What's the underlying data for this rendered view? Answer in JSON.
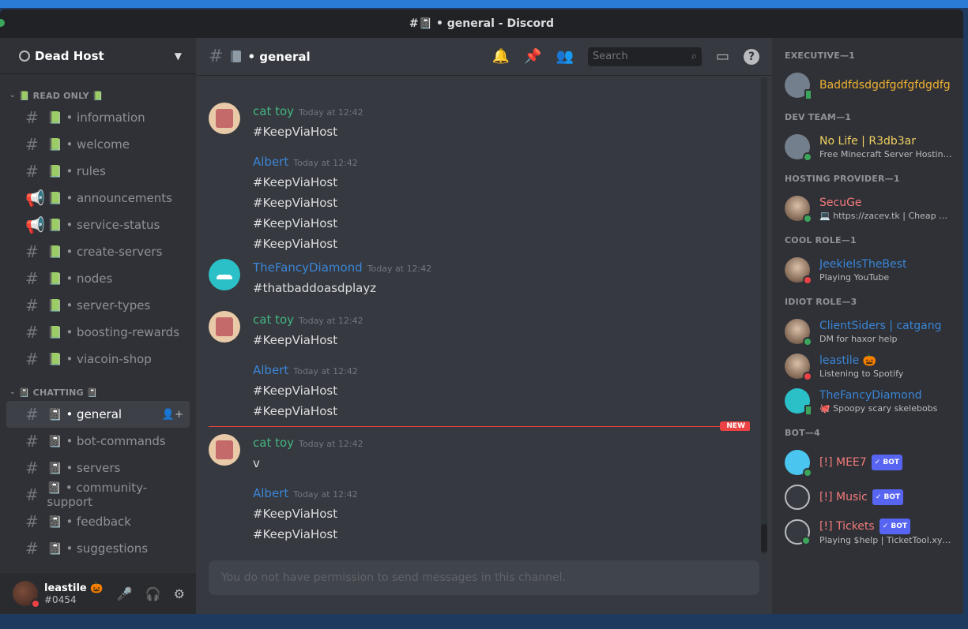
{
  "window": {
    "title": "#📓 • general - Discord"
  },
  "server": {
    "name": "Dead Host"
  },
  "categories": [
    {
      "label": "📗 READ ONLY 📗",
      "channels": [
        {
          "name": "📗 • information",
          "type": "text"
        },
        {
          "name": "📗 • welcome",
          "type": "text"
        },
        {
          "name": "📗 • rules",
          "type": "text"
        },
        {
          "name": "📗 • announcements",
          "type": "announcement"
        },
        {
          "name": "📗 • service-status",
          "type": "announcement"
        },
        {
          "name": "📗 • create-servers",
          "type": "text"
        },
        {
          "name": "📗 • nodes",
          "type": "text"
        },
        {
          "name": "📗 • server-types",
          "type": "text"
        },
        {
          "name": "📗 • boosting-rewards",
          "type": "text"
        },
        {
          "name": "📗 • viacoin-shop",
          "type": "text"
        }
      ]
    },
    {
      "label": "📓 CHATTING 📓",
      "channels": [
        {
          "name": "📓 • general",
          "type": "text",
          "active": true
        },
        {
          "name": "📓 • bot-commands",
          "type": "text"
        },
        {
          "name": "📓 • servers",
          "type": "text"
        },
        {
          "name": "📓 • community-support",
          "type": "text"
        },
        {
          "name": "📓 • feedback",
          "type": "text"
        },
        {
          "name": "📓 • suggestions",
          "type": "text"
        }
      ]
    }
  ],
  "user_panel": {
    "username": "leastile 🎃",
    "tag": "#0454"
  },
  "channel_header": {
    "name": "• general",
    "search_placeholder": "Search"
  },
  "messages": [
    {
      "author": "cat toy",
      "author_color": "#43b581",
      "avatar": "cat",
      "time": "Today at 12:42",
      "lines": [
        "#KeepViaHost"
      ]
    },
    {
      "author": "Albert",
      "author_color": "#3a86d8",
      "avatar": "none",
      "time": "Today at 12:42",
      "lines": [
        "#KeepViaHost",
        "#KeepViaHost",
        "#KeepViaHost",
        "#KeepViaHost"
      ]
    },
    {
      "author": "TheFancyDiamond",
      "author_color": "#3a86d8",
      "avatar": "diamond",
      "time": "Today at 12:42",
      "lines": [
        "#thatbaddoasdplayz"
      ]
    },
    {
      "author": "cat toy",
      "author_color": "#43b581",
      "avatar": "cat",
      "time": "Today at 12:42",
      "lines": [
        "#KeepViaHost"
      ]
    },
    {
      "author": "Albert",
      "author_color": "#3a86d8",
      "avatar": "none",
      "time": "Today at 12:42",
      "lines": [
        "#KeepViaHost",
        "#KeepViaHost"
      ]
    },
    {
      "author": "cat toy",
      "author_color": "#43b581",
      "avatar": "cat",
      "time": "Today at 12:42",
      "lines": [
        "v"
      ]
    },
    {
      "author": "Albert",
      "author_color": "#3a86d8",
      "avatar": "none",
      "time": "Today at 12:42",
      "lines": [
        "#KeepViaHost",
        "#KeepViaHost"
      ]
    }
  ],
  "new_badge": "NEW",
  "input_placeholder": "You do not have permission to send messages in this channel.",
  "members": [
    {
      "role": "EXECUTIVE—1",
      "users": [
        {
          "name": "Baddfdsdgdfgdfgfdgdfg",
          "color": "#f0b232",
          "sub": "",
          "avatar": "discord",
          "status": "mobile"
        }
      ]
    },
    {
      "role": "DEV TEAM—1",
      "users": [
        {
          "name": "No Life | R3db3ar",
          "color": "#f0d060",
          "sub": "Free Minecraft Server Hosting ...",
          "avatar": "discord",
          "status": "online"
        }
      ]
    },
    {
      "role": "HOSTING PROVIDER—1",
      "users": [
        {
          "name": "SecuGe",
          "color": "#f47b7b",
          "sub": "💻 https://zacev.tk | Cheap H...",
          "avatar": "person",
          "status": "online"
        }
      ]
    },
    {
      "role": "COOL ROLE—1",
      "users": [
        {
          "name": "JeekieIsTheBest",
          "color": "#3a86d8",
          "sub": "Playing YouTube",
          "avatar": "person",
          "status": "dnd"
        }
      ]
    },
    {
      "role": "IDIOT ROLE—3",
      "users": [
        {
          "name": "ClientSiders | catgang",
          "color": "#3a86d8",
          "sub": "DM for haxor help",
          "avatar": "person",
          "status": "online"
        },
        {
          "name": "leastile 🎃",
          "color": "#3a86d8",
          "sub": "Listening to Spotify",
          "avatar": "person",
          "status": "dnd"
        },
        {
          "name": "TheFancyDiamond",
          "color": "#3a86d8",
          "sub": "🐙 Spoopy scary skelebobs",
          "avatar": "teal",
          "status": "mobile"
        }
      ]
    },
    {
      "role": "BOT—4",
      "users": [
        {
          "name": "[!] MEE7",
          "color": "#f47b7b",
          "sub": "",
          "avatar": "blue",
          "status": "online",
          "bot": "✓ BOT"
        },
        {
          "name": "[!] Music",
          "color": "#f47b7b",
          "sub": "",
          "avatar": "dark",
          "status": "",
          "bot": "✓ BOT"
        },
        {
          "name": "[!] Tickets",
          "color": "#f47b7b",
          "sub": "Playing $help | TicketTool.xyz ...",
          "avatar": "dark",
          "status": "online",
          "bot": "✓ BOT"
        }
      ]
    }
  ]
}
